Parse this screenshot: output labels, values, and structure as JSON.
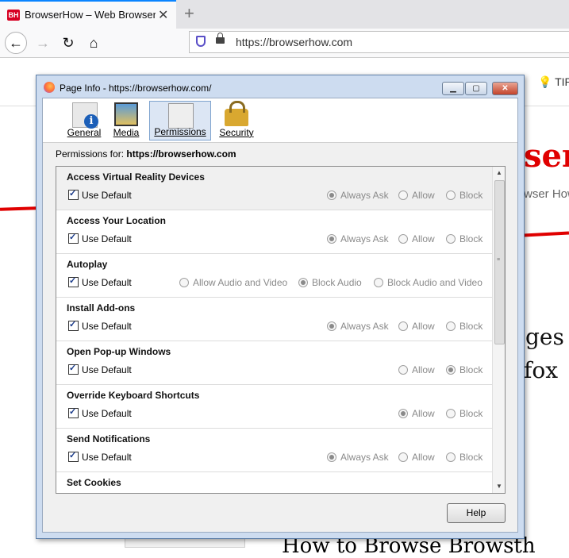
{
  "browser": {
    "tab_title": "BrowserHow – Web Browser Ho",
    "favicon_text": "BH",
    "close_glyph": "✕",
    "new_tab_glyph": "+",
    "url": "https://browserhow.com",
    "nav_back": "←",
    "nav_forward": "→",
    "nav_reload": "↻",
    "nav_home": "⌂"
  },
  "page_behind": {
    "tips": "TIPS",
    "brand": "ser",
    "brand_sub": "wser How",
    "text1": "ges f",
    "text2": "fox",
    "bottom_text": "How to Browse Browsth"
  },
  "dialog": {
    "title": "Page Info - https://browserhow.com/",
    "min_glyph": "▁",
    "max_glyph": "▢",
    "close_glyph": "✕",
    "tabs": [
      {
        "label": "General",
        "icon": "info-icon"
      },
      {
        "label": "Media",
        "icon": "media-icon"
      },
      {
        "label": "Permissions",
        "icon": "permissions-icon",
        "selected": true
      },
      {
        "label": "Security",
        "icon": "lock-icon"
      }
    ],
    "perm_for_label": "Permissions for:",
    "perm_for_site": "https://browserhow.com",
    "use_default": "Use Default",
    "permissions": [
      {
        "title": "Access Virtual Reality Devices",
        "options": [
          "Always Ask",
          "Allow",
          "Block"
        ],
        "selected": "Always Ask"
      },
      {
        "title": "Access Your Location",
        "options": [
          "Always Ask",
          "Allow",
          "Block"
        ],
        "selected": "Always Ask"
      },
      {
        "title": "Autoplay",
        "options": [
          "Allow Audio and Video",
          "Block Audio",
          "Block Audio and Video"
        ],
        "selected": "Block Audio"
      },
      {
        "title": "Install Add-ons",
        "options": [
          "Always Ask",
          "Allow",
          "Block"
        ],
        "selected": "Always Ask"
      },
      {
        "title": "Open Pop-up Windows",
        "options": [
          "Allow",
          "Block"
        ],
        "selected": "Block"
      },
      {
        "title": "Override Keyboard Shortcuts",
        "options": [
          "Allow",
          "Block"
        ],
        "selected": "Allow"
      },
      {
        "title": "Send Notifications",
        "options": [
          "Always Ask",
          "Allow",
          "Block"
        ],
        "selected": "Always Ask"
      },
      {
        "title": "Set Cookies",
        "options": [],
        "selected": ""
      }
    ],
    "help": "Help"
  }
}
